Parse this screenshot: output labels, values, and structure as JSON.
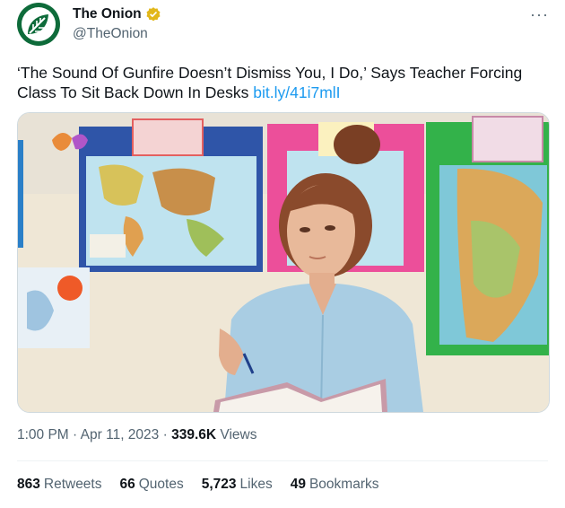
{
  "author": {
    "name": "The Onion",
    "handle": "@TheOnion"
  },
  "tweet": {
    "text": "‘The Sound Of Gunfire Doesn’t Dismiss You, I Do,’ Says Teacher Forcing Class To Sit Back Down In Desks",
    "link": "bit.ly/41i7mlI"
  },
  "meta": {
    "time": "1:00 PM",
    "date": "Apr 11, 2023",
    "views_count": "339.6K",
    "views_label": "Views"
  },
  "stats": [
    {
      "count": "863",
      "label": "Retweets"
    },
    {
      "count": "66",
      "label": "Quotes"
    },
    {
      "count": "5,723",
      "label": "Likes"
    },
    {
      "count": "49",
      "label": "Bookmarks"
    }
  ],
  "colors": {
    "accent": "#1d9bf0",
    "verified": "#e2b719",
    "brand": "#0e6b3a"
  },
  "icons": {
    "avatar": "onion-logo-icon",
    "verified": "verified-badge-icon",
    "more": "more-options-icon"
  }
}
